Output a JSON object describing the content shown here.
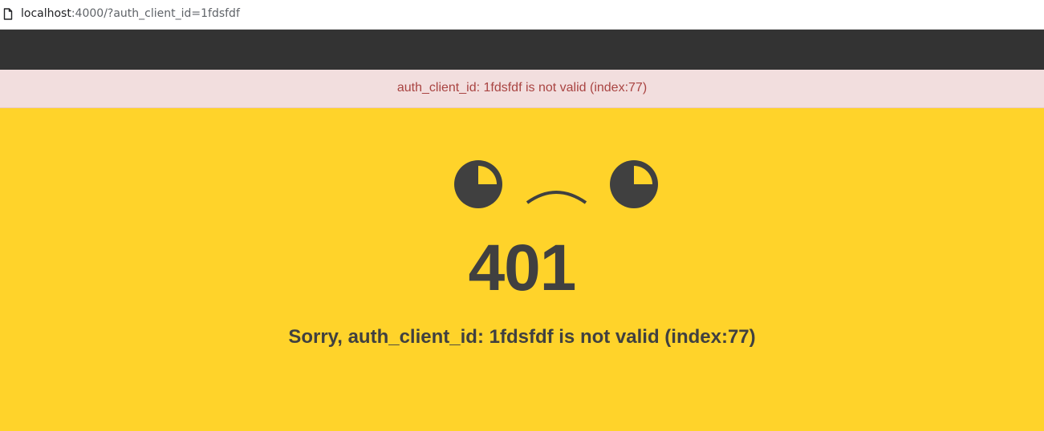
{
  "browser": {
    "url_host": "localhost",
    "url_rest": ":4000/?auth_client_id=1fdsfdf",
    "page_icon": "page-icon"
  },
  "alert": {
    "text": "auth_client_id: 1fdsfdf is not valid (index:77)",
    "background_color": "#f2dede",
    "text_color": "#a94442"
  },
  "error": {
    "face_icon": "sad-face-icon",
    "code": "401",
    "message": "Sorry, auth_client_id: 1fdsfdf is not valid (index:77)"
  },
  "colors": {
    "page_background": "#ffd32a",
    "navbar": "#333333",
    "foreground": "#404040"
  }
}
